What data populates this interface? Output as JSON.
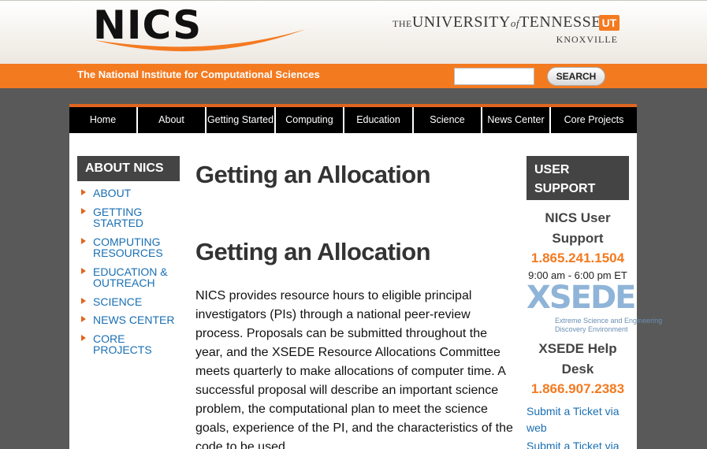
{
  "header": {
    "logo_text": "NICS",
    "university_line": {
      "the": "THE",
      "university": "UNIVERSITY",
      "of": "of",
      "state": "TENNESSEE"
    },
    "ut_mark": "UT",
    "campus": "KNOXVILLE",
    "tagline": "The National Institute for Computational Sciences",
    "search": {
      "placeholder": "",
      "button_label": "SEARCH"
    }
  },
  "nav": {
    "items": [
      {
        "label": "Home"
      },
      {
        "label": "About"
      },
      {
        "label": "Getting Started"
      },
      {
        "label": "Computing"
      },
      {
        "label": "Education"
      },
      {
        "label": "Science"
      },
      {
        "label": "News Center"
      },
      {
        "label": "Core Projects"
      }
    ]
  },
  "left_sidebar": {
    "heading": "ABOUT NICS",
    "items": [
      {
        "label": "ABOUT"
      },
      {
        "label": "GETTING STARTED"
      },
      {
        "label": "COMPUTING RESOURCES"
      },
      {
        "label": "EDUCATION & OUTREACH"
      },
      {
        "label": "SCIENCE"
      },
      {
        "label": "NEWS CENTER"
      },
      {
        "label": "CORE PROJECTS"
      }
    ]
  },
  "content": {
    "page_title": "Getting an Allocation",
    "section_title": "Getting an Allocation",
    "paragraph": "NICS provides resource hours to eligible principal investigators (PIs) through a national peer-review process. Proposals can be submitted throughout the year, and the XSEDE Resource Allocations Committee meets quarterly to make allocations of computer time. A successful proposal will describe an important science problem, the computational plan to meet the science goals, experience of the PI, and the characteristics of the code to be used."
  },
  "right_sidebar": {
    "heading": "USER SUPPORT",
    "nics_title": "NICS User Support",
    "nics_phone": "1.865.241.1504",
    "hours": "9:00 am - 6:00 pm ET",
    "xsede_logo": "XSEDE",
    "xsede_tagline_1": "Extreme Science and Engineering",
    "xsede_tagline_2": "Discovery Environment",
    "xsede_title": "XSEDE Help Desk",
    "xsede_phone": "1.866.907.2383",
    "link_web": "Submit a Ticket via web",
    "link_email": "Submit a Ticket via email"
  },
  "colors": {
    "accent": "#f47a20",
    "link": "#1a6fb3",
    "nav_bg": "#000000",
    "sidebar_heading_bg": "#444444"
  }
}
